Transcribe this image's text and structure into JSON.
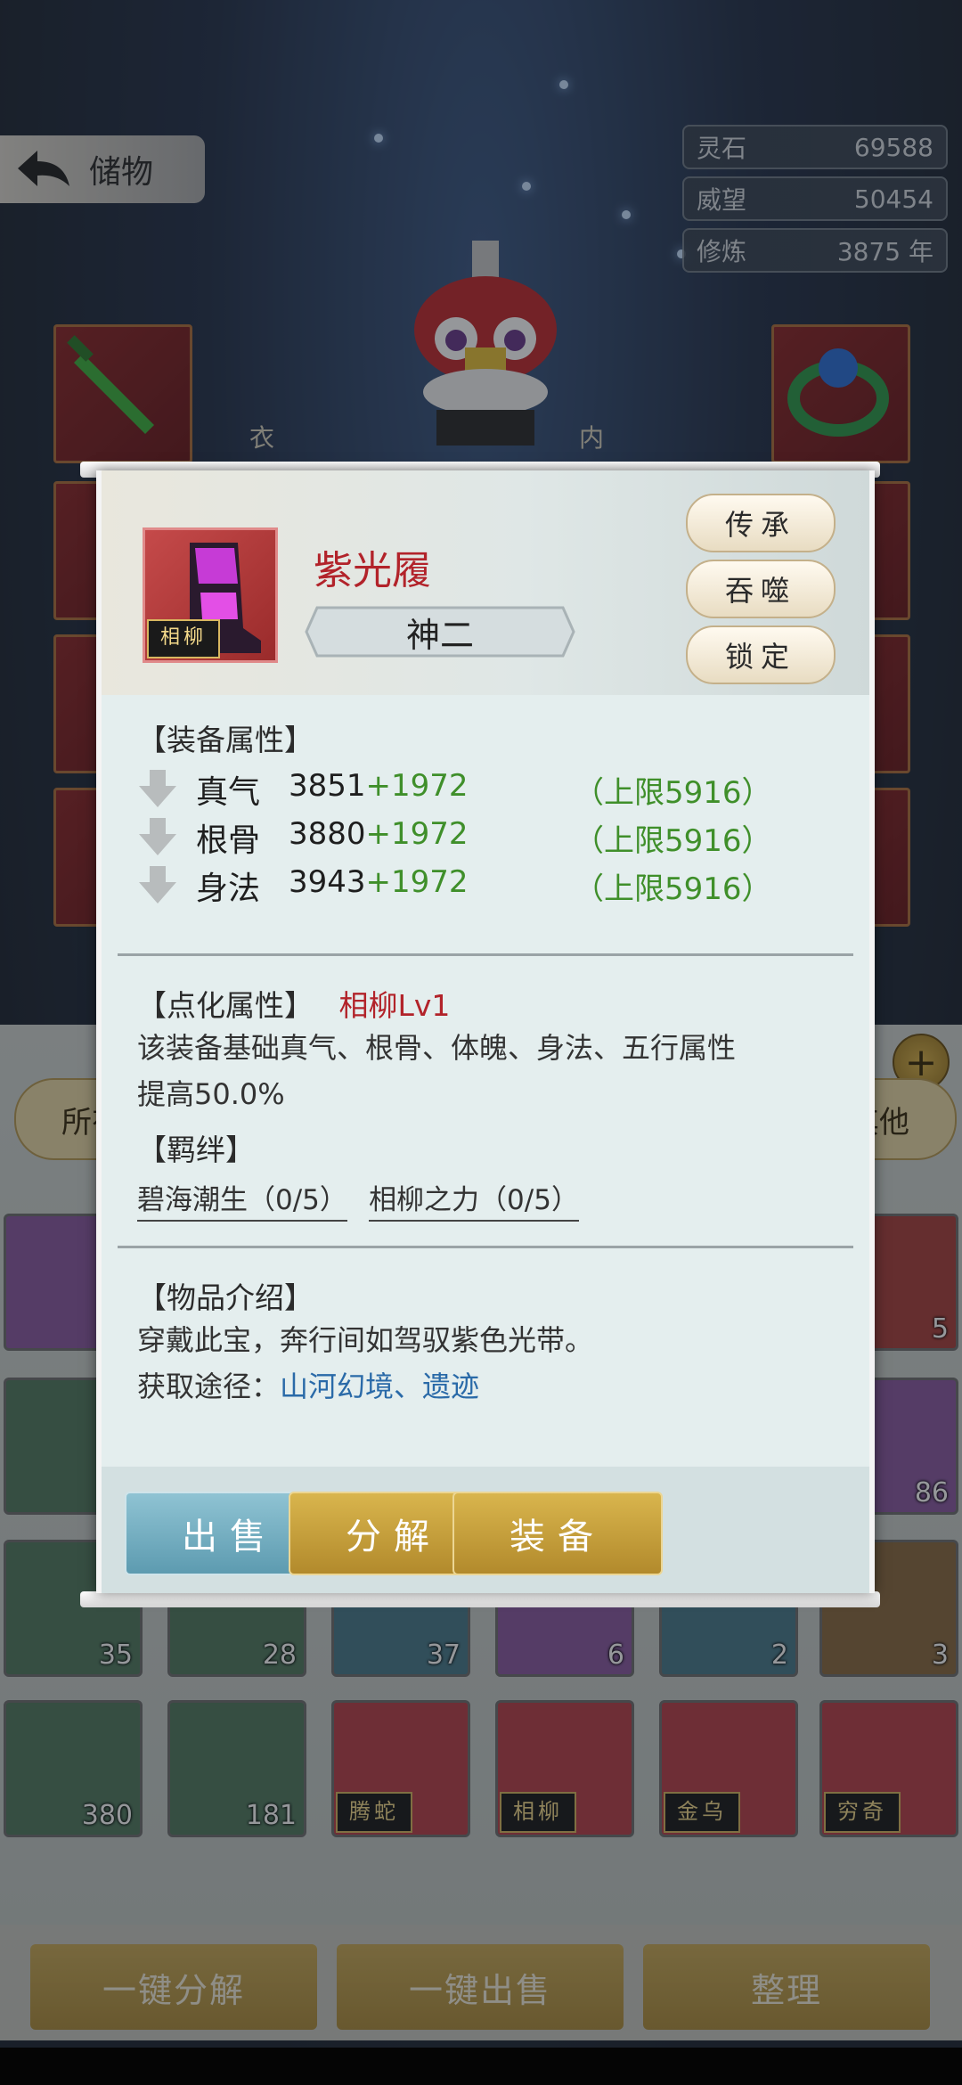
{
  "header": {
    "back_label": "储物",
    "resources": [
      {
        "label": "灵石",
        "value": "69588"
      },
      {
        "label": "威望",
        "value": "50454"
      },
      {
        "label": "修炼",
        "value": "3875 年"
      }
    ]
  },
  "background": {
    "slot_labels": [
      "衣",
      "内"
    ],
    "tabs": [
      "所有",
      "其他"
    ],
    "grid_counts": {
      "row1_last": "5",
      "row2_last": "86",
      "row3": [
        "35",
        "28",
        "37",
        "6",
        "2",
        "3"
      ],
      "row4": [
        "380",
        "181"
      ]
    },
    "seals": [
      "腾蛇",
      "相柳",
      "金乌",
      "穷奇"
    ],
    "bottom_buttons": [
      "一键分解",
      "一键出售",
      "整理"
    ]
  },
  "dialog": {
    "item": {
      "name": "紫光履",
      "tier": "神二",
      "seal": "相柳"
    },
    "side_buttons": [
      "传承",
      "吞噬",
      "锁定"
    ],
    "equip_section_title": "【装备属性】",
    "stats": [
      {
        "name": "真气",
        "base": "3851",
        "bonus": "+1972",
        "cap": "（上限5916）"
      },
      {
        "name": "根骨",
        "base": "3880",
        "bonus": "+1972",
        "cap": "（上限5916）"
      },
      {
        "name": "身法",
        "base": "3943",
        "bonus": "+1972",
        "cap": "（上限5916）"
      }
    ],
    "refine_title": "【点化属性】",
    "refine_value": "相柳Lv1",
    "refine_desc_1": "该装备基础真气、根骨、体魄、身法、五行属性",
    "refine_desc_2": "提高50.0%",
    "bond_title": "【羁绊】",
    "bonds": [
      "碧海潮生（0/5）",
      "相柳之力（0/5）"
    ],
    "intro_title": "【物品介绍】",
    "intro_text": "穿戴此宝，奔行间如驾驭紫色光带。",
    "source_label": "获取途径：",
    "source_value": "山河幻境、遗迹",
    "actions": [
      "出售",
      "分解",
      "装备"
    ]
  },
  "colors": {
    "item_name": "#b2232a",
    "stat_bonus": "#3f8f2a",
    "source_link": "#2a6aa8",
    "btn_sell": "#6fa9bd",
    "btn_gold": "#c49d3b"
  }
}
